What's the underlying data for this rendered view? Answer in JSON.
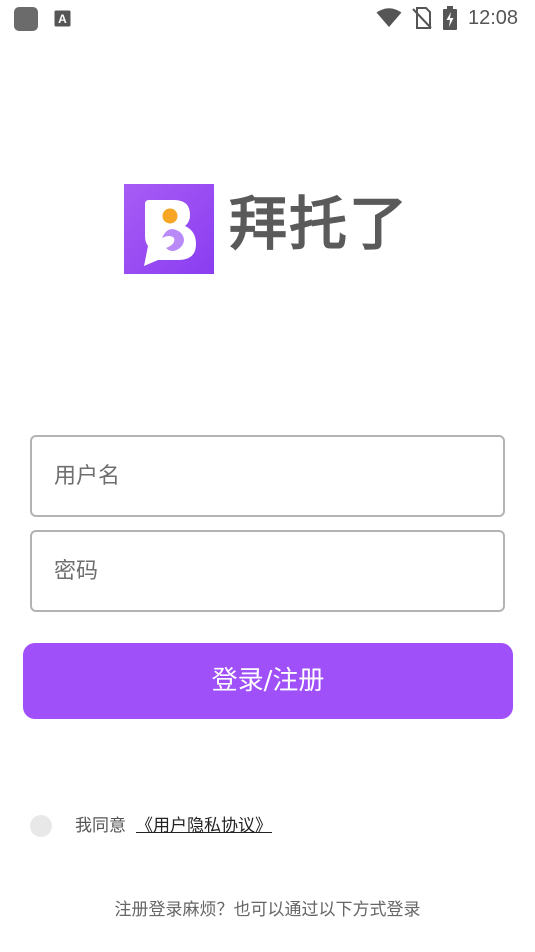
{
  "status_bar": {
    "time": "12:08",
    "icons": [
      "app-icon",
      "text-a-icon",
      "wifi-icon",
      "no-sim-icon",
      "battery-charging-icon"
    ],
    "icon_color": "#555555"
  },
  "brand": {
    "app_name": "拜托了",
    "logo_letter": "B",
    "logo_colors": {
      "tile": "#9a4ff4",
      "dot": "#f6a623"
    }
  },
  "form": {
    "username_placeholder": "用户名",
    "username_value": "",
    "password_placeholder": "密码",
    "password_value": ""
  },
  "login_button": {
    "label": "登录/注册",
    "color": "#a050f8"
  },
  "agreement": {
    "checked": false,
    "text": "我同意",
    "link_text": "《用户隐私协议》"
  },
  "alt_login_hint": "注册登录麻烦？也可以通过以下方式登录"
}
